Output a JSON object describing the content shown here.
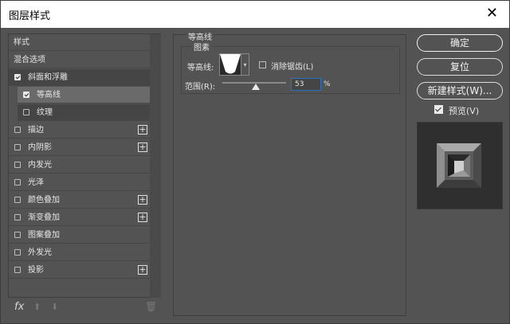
{
  "window": {
    "title": "图层样式",
    "close": "✕"
  },
  "left_panel": {
    "items": [
      {
        "label": "样式"
      },
      {
        "label": "混合选项"
      },
      {
        "label": "斜面和浮雕",
        "checked": true
      },
      {
        "label": "等高线",
        "checked": true
      },
      {
        "label": "纹理",
        "checked": false
      },
      {
        "label": "描边",
        "checked": false,
        "plus": "+"
      },
      {
        "label": "内阴影",
        "checked": false,
        "plus": "+"
      },
      {
        "label": "内发光",
        "checked": false
      },
      {
        "label": "光泽",
        "checked": false
      },
      {
        "label": "颜色叠加",
        "checked": false,
        "plus": "+"
      },
      {
        "label": "渐变叠加",
        "checked": false,
        "plus": "+"
      },
      {
        "label": "图案叠加",
        "checked": false
      },
      {
        "label": "外发光",
        "checked": false
      },
      {
        "label": "投影",
        "checked": false,
        "plus": "+"
      }
    ],
    "fx_label": "fx",
    "up_arrow": "⬆",
    "down_arrow": "⬇",
    "trash": "🗑"
  },
  "contour_panel": {
    "group_title": "等高线",
    "subgroup_title": "图素",
    "contour_label": "等高线:",
    "antialias_label": "消除锯齿(L)",
    "antialias_checked": false,
    "range_label": "范围(R):",
    "range_value": "53",
    "range_unit": "%",
    "range_fraction": 0.53
  },
  "buttons": {
    "ok": "确定",
    "reset": "复位",
    "new_style": "新建样式(W)...",
    "preview_label": "预览(V)",
    "preview_checked": true
  }
}
